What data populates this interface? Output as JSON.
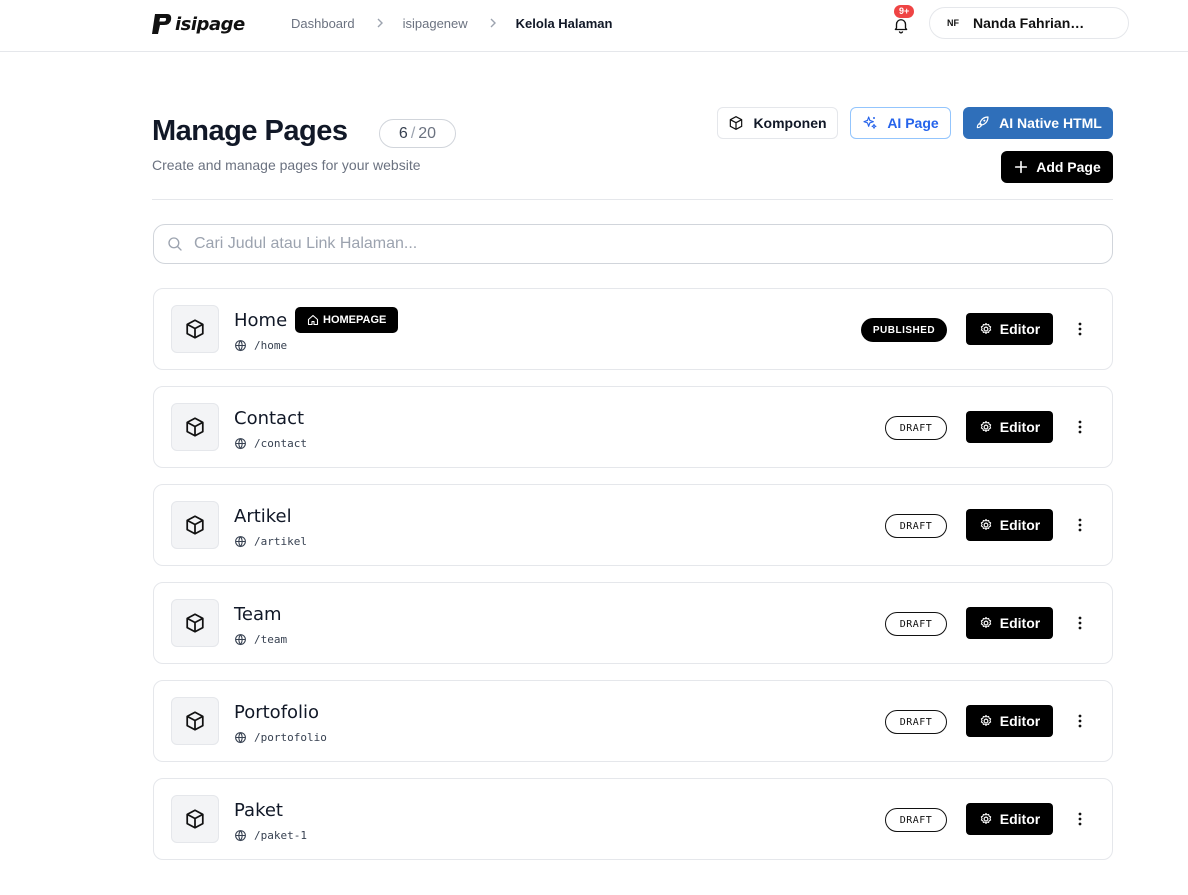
{
  "brand": {
    "name": "isipage"
  },
  "breadcrumb": [
    {
      "label": "Dashboard"
    },
    {
      "label": "isipagenew"
    },
    {
      "label": "Kelola Halaman"
    }
  ],
  "notifications": {
    "badge": "9+"
  },
  "user": {
    "initials": "NF",
    "name": "Nanda Fahriansyah"
  },
  "header": {
    "title": "Manage Pages",
    "count_current": "6",
    "count_sep": "/",
    "count_total": "20",
    "subtitle": "Create and manage pages for your website"
  },
  "actions": {
    "komponen": "Komponen",
    "ai_page": "AI Page",
    "ai_native_html": "AI Native HTML",
    "add_page": "Add Page"
  },
  "search": {
    "placeholder": "Cari Judul atau Link Halaman..."
  },
  "colors": {
    "accent_blue": "#2f6fba",
    "badge_red": "#ef4444",
    "ai_page_blue": "#2563eb"
  },
  "pages": [
    {
      "title": "Home",
      "url": "/home",
      "status": "PUBLISHED",
      "homepage": "HOMEPAGE",
      "editor": "Editor"
    },
    {
      "title": "Contact",
      "url": "/contact",
      "status": "DRAFT",
      "editor": "Editor"
    },
    {
      "title": "Artikel",
      "url": "/artikel",
      "status": "DRAFT",
      "editor": "Editor"
    },
    {
      "title": "Team",
      "url": "/team",
      "status": "DRAFT",
      "editor": "Editor"
    },
    {
      "title": "Portofolio",
      "url": "/portofolio",
      "status": "DRAFT",
      "editor": "Editor"
    },
    {
      "title": "Paket",
      "url": "/paket-1",
      "status": "DRAFT",
      "editor": "Editor"
    }
  ]
}
